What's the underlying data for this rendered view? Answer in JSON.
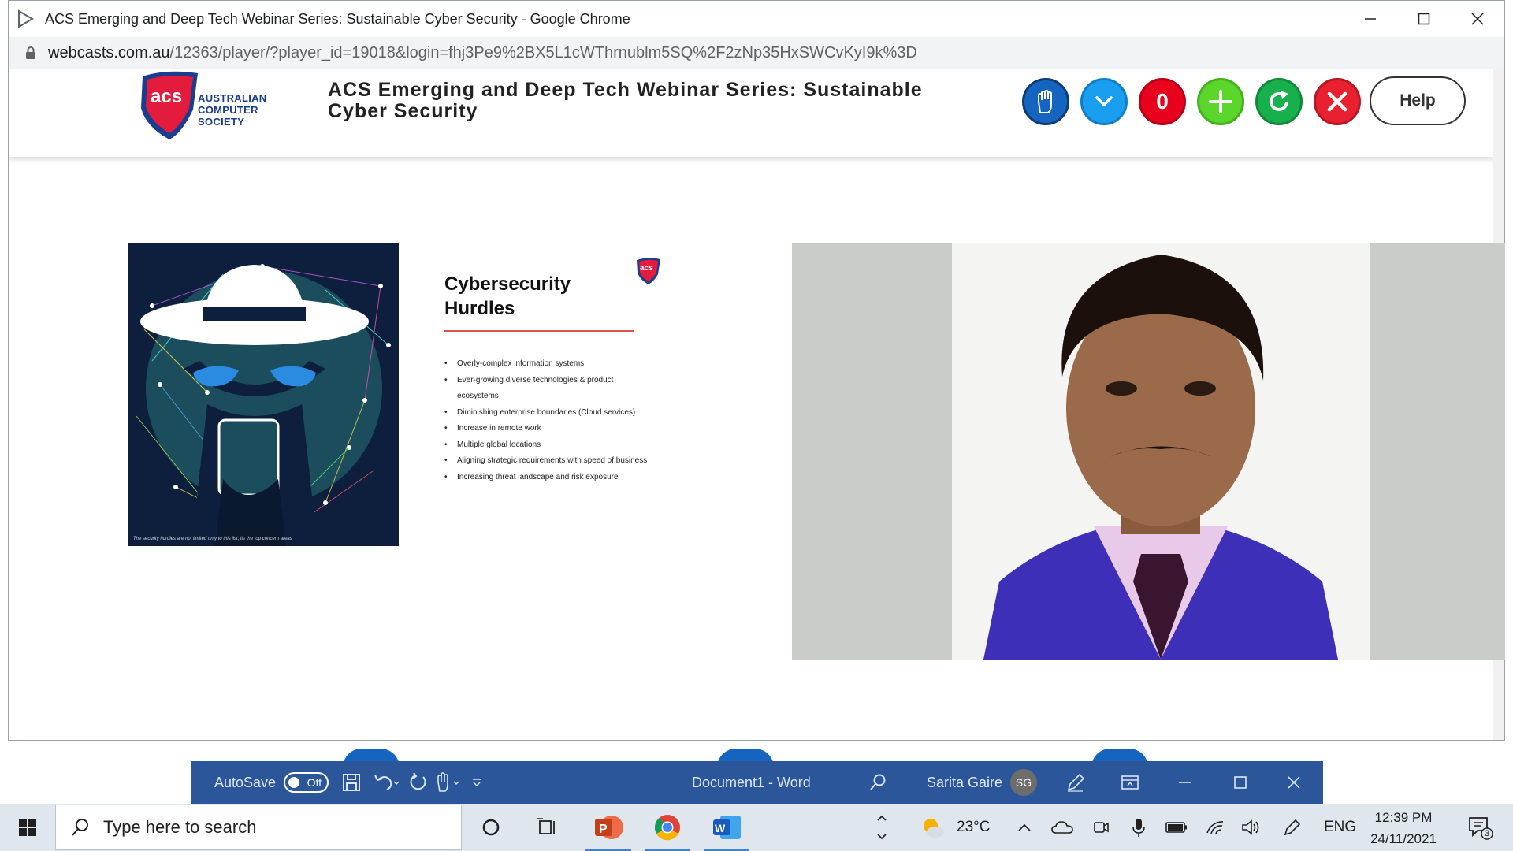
{
  "window": {
    "title": "ACS Emerging and Deep Tech Webinar Series: Sustainable Cyber Security - Google Chrome",
    "url_host": "webcasts.com.au",
    "url_path": "/12363/player/?player_id=19018&login=fhj3Pe9%2BX5L1cWThrnublm5SQ%2F2zNp35HxSWCvKyI9k%3D"
  },
  "header": {
    "logo_text": "AUSTRALIAN COMPUTER SOCIETY",
    "title": "ACS Emerging and Deep Tech Webinar Series: Sustainable Cyber Security",
    "counter": "0",
    "help_label": "Help",
    "colors": {
      "hand": "#1565c0",
      "chevron": "#1a9ff0",
      "counter": "#e8001c",
      "plus": "#5bd62b",
      "refresh": "#17b04c",
      "close": "#e8202f"
    }
  },
  "slide": {
    "heading_line1": "Cybersecurity",
    "heading_line2": "Hurdles",
    "bullets": [
      "Overly-complex information systems",
      "Ever-growing diverse technologies & product ecosystems",
      "Diminishing enterprise boundaries (Cloud services)",
      "Increase in remote work",
      "Multiple global locations",
      "Aligning strategic requirements with speed of business",
      "Increasing threat landscape and risk exposure"
    ],
    "caption": "The security hurdles are not limited only to this list, its the top concern areas"
  },
  "word": {
    "autosave_label": "AutoSave",
    "toggle_state": "Off",
    "document_title": "Document1  -  Word",
    "user_name": "Sarita Gaire",
    "user_initials": "SG"
  },
  "taskbar": {
    "search_placeholder": "Type here to search",
    "temperature": "23°C",
    "language": "ENG",
    "time": "12:39 PM",
    "date": "24/11/2021",
    "notification_count": "3"
  }
}
